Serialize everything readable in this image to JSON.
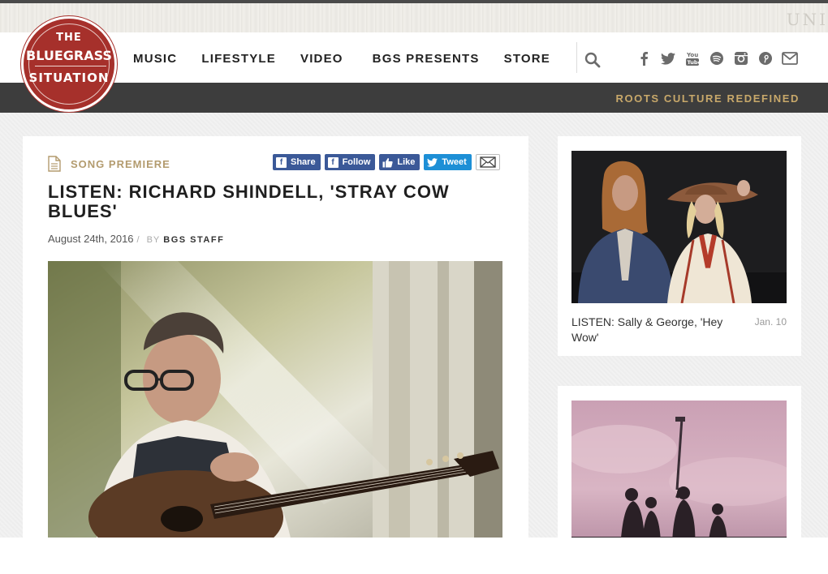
{
  "header": {
    "logo": {
      "line1": "THE",
      "line2": "BLUEGRASS",
      "line3": "SITUATION"
    },
    "ghost_text": "UNI",
    "nav": [
      "MUSIC",
      "LIFESTYLE",
      "VIDEO",
      "BGS PRESENTS",
      "STORE"
    ],
    "social_icons": [
      "facebook-icon",
      "twitter-icon",
      "youtube-icon",
      "spotify-icon",
      "instagram-icon",
      "pinterest-icon",
      "email-icon"
    ],
    "tagline": "ROOTS CULTURE REDEFINED"
  },
  "article": {
    "category": "SONG PREMIERE",
    "share": {
      "share_label": "Share",
      "follow_label": "Follow",
      "like_label": "Like",
      "tweet_label": "Tweet"
    },
    "title": "LISTEN: RICHARD SHINDELL, 'STRAY COW BLUES'",
    "date": "August 24th, 2016",
    "by": "BY",
    "author": "BGS STAFF"
  },
  "sidebar": {
    "card1": {
      "headline": "LISTEN: Sally & George, 'Hey Wow'",
      "date": "Jan. 10"
    }
  },
  "colors": {
    "brand_red": "#a6302b",
    "accent_gold": "#c8a86a",
    "facebook_blue": "#3b5998",
    "twitter_blue": "#1d8fd6",
    "dark_bar": "#3d3d3d"
  }
}
